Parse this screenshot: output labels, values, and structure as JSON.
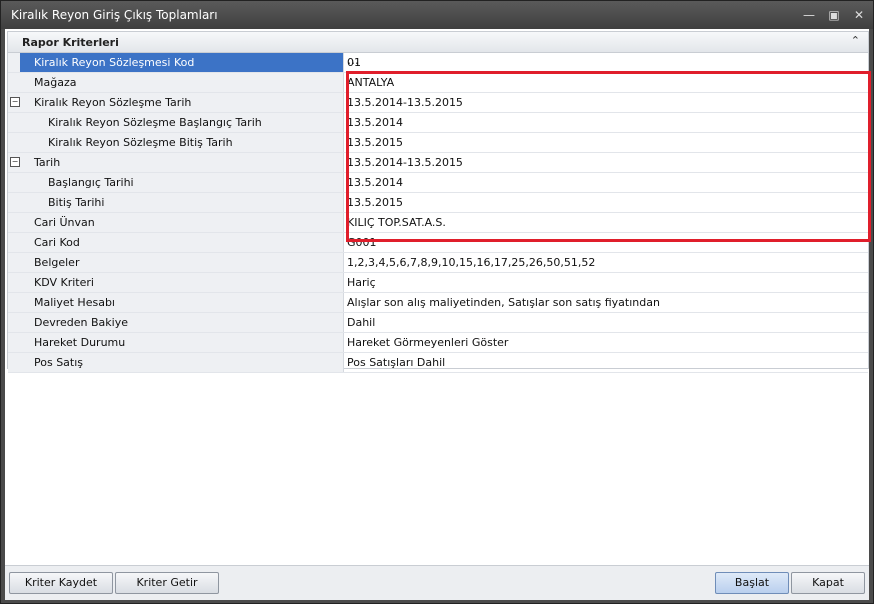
{
  "window": {
    "title": "Kiralık Reyon Giriş Çıkış Toplamları"
  },
  "panel": {
    "title": "Rapor Kriterleri"
  },
  "rows": [
    {
      "label": "Kiralık Reyon Sözleşmesi Kod",
      "value": "01"
    },
    {
      "label": "Mağaza",
      "value": "ANTALYA"
    },
    {
      "label": "Kiralık Reyon Sözleşme Tarih",
      "value": "13.5.2014-13.5.2015"
    },
    {
      "label": "Kiralık Reyon Sözleşme Başlangıç Tarih",
      "value": "13.5.2014"
    },
    {
      "label": "Kiralık Reyon Sözleşme Bitiş Tarih",
      "value": "13.5.2015"
    },
    {
      "label": "Tarih",
      "value": "13.5.2014-13.5.2015"
    },
    {
      "label": "Başlangıç Tarihi",
      "value": "13.5.2014"
    },
    {
      "label": "Bitiş Tarihi",
      "value": "13.5.2015"
    },
    {
      "label": "Cari Ünvan",
      "value": "KILIÇ TOP.SAT.A.S."
    },
    {
      "label": "Cari Kod",
      "value": "G001"
    },
    {
      "label": "Belgeler",
      "value": "1,2,3,4,5,6,7,8,9,10,15,16,17,25,26,50,51,52"
    },
    {
      "label": "KDV Kriteri",
      "value": "Hariç"
    },
    {
      "label": "Maliyet Hesabı",
      "value": "Alışlar son alış maliyetinden, Satışlar son satış fiyatından"
    },
    {
      "label": "Devreden Bakiye",
      "value": "Dahil"
    },
    {
      "label": "Hareket Durumu",
      "value": "Hareket Görmeyenleri Göster"
    },
    {
      "label": "Pos Satış",
      "value": "Pos Satışları Dahil"
    }
  ],
  "buttons": {
    "save": "Kriter Kaydet",
    "load": "Kriter Getir",
    "start": "Başlat",
    "close": "Kapat"
  },
  "colors": {
    "selection": "#3c73c6",
    "highlight": "#e01e2b"
  }
}
